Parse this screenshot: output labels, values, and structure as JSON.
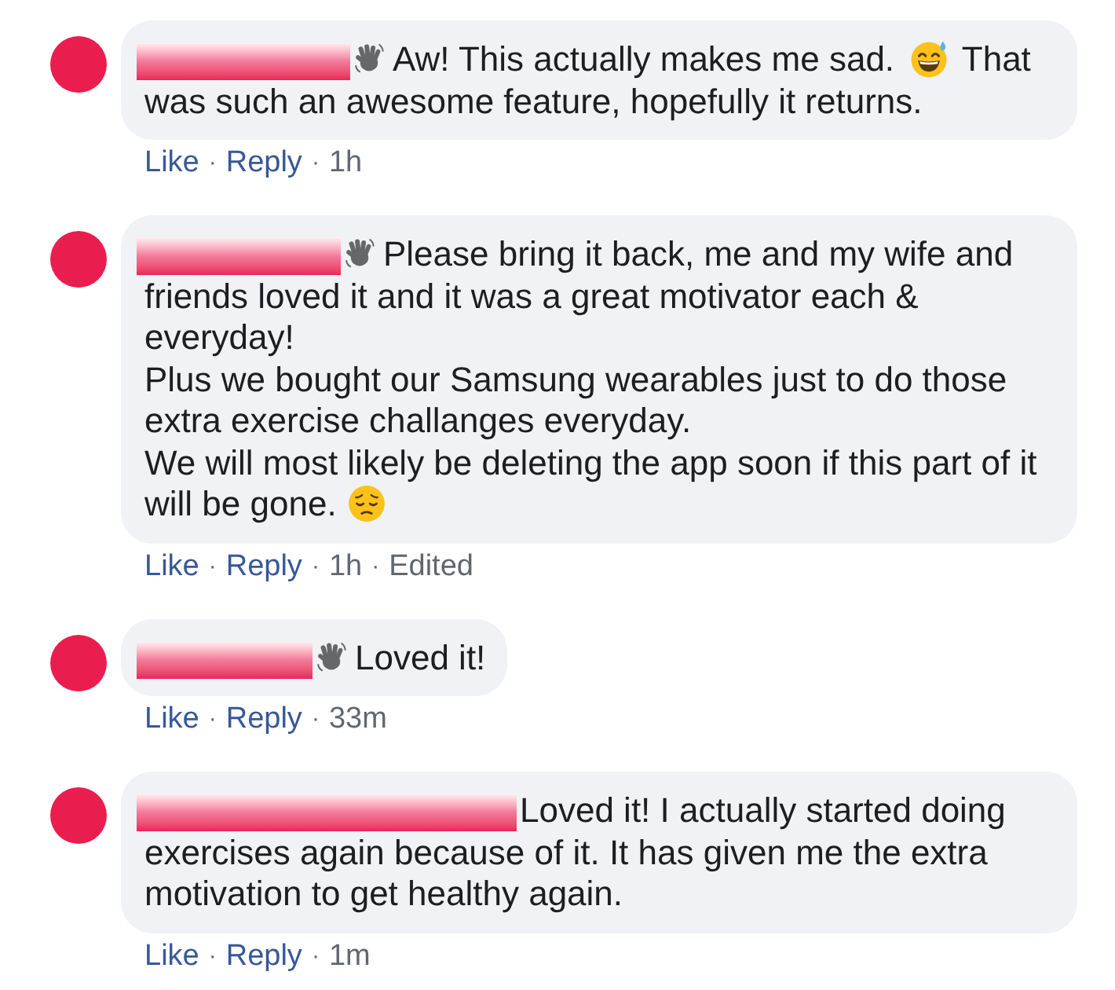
{
  "comments": [
    {
      "badge": true,
      "paragraphs": [
        [
          {
            "kind": "text",
            "text": "Aw! This actually makes me sad."
          },
          {
            "kind": "sweat-smile"
          },
          {
            "kind": "text",
            "text": "That was such an awesome feature, hopefully it returns."
          }
        ]
      ],
      "footer": [
        {
          "kind": "link",
          "text": "Like"
        },
        {
          "kind": "dot",
          "text": "·"
        },
        {
          "kind": "link",
          "text": "Reply"
        },
        {
          "kind": "dot",
          "text": "·"
        },
        {
          "kind": "time",
          "text": "1h"
        }
      ]
    },
    {
      "badge": true,
      "paragraphs": [
        [
          {
            "kind": "text",
            "text": "Please bring it back, me and my wife and friends loved it and it was a great motivator each & everyday!"
          }
        ],
        [
          {
            "kind": "text",
            "text": "Plus we bought our Samsung wearables just to do those extra exercise challanges everyday."
          }
        ],
        [
          {
            "kind": "text",
            "text": "We will most likely be deleting the app soon if this part of it will be gone."
          },
          {
            "kind": "pensive"
          }
        ]
      ],
      "footer": [
        {
          "kind": "link",
          "text": "Like"
        },
        {
          "kind": "dot",
          "text": "·"
        },
        {
          "kind": "link",
          "text": "Reply"
        },
        {
          "kind": "dot",
          "text": "·"
        },
        {
          "kind": "time",
          "text": "1h"
        },
        {
          "kind": "dot",
          "text": "·"
        },
        {
          "kind": "label",
          "text": "Edited"
        }
      ]
    },
    {
      "badge": true,
      "paragraphs": [
        [
          {
            "kind": "text",
            "text": "Loved it!"
          }
        ]
      ],
      "footer": [
        {
          "kind": "link",
          "text": "Like"
        },
        {
          "kind": "dot",
          "text": "·"
        },
        {
          "kind": "link",
          "text": "Reply"
        },
        {
          "kind": "dot",
          "text": "·"
        },
        {
          "kind": "time",
          "text": "33m"
        }
      ]
    },
    {
      "badge": false,
      "paragraphs": [
        [
          {
            "kind": "text",
            "text": "Loved it! I actually started doing exercises again because of it. It has given me the extra motivation to get healthy again."
          }
        ]
      ],
      "footer": [
        {
          "kind": "link",
          "text": "Like"
        },
        {
          "kind": "dot",
          "text": "·"
        },
        {
          "kind": "link",
          "text": "Reply"
        },
        {
          "kind": "dot",
          "text": "·"
        },
        {
          "kind": "time",
          "text": "1m"
        }
      ]
    }
  ]
}
